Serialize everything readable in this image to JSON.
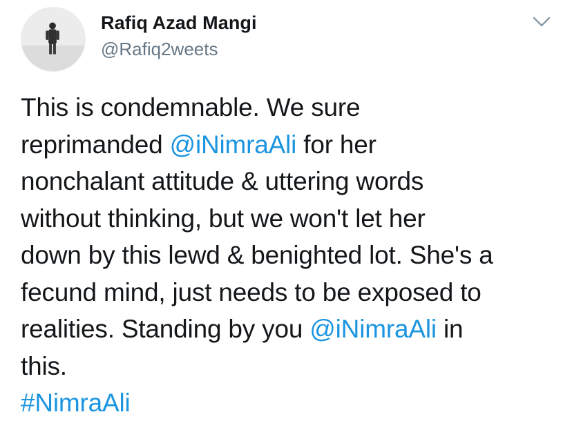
{
  "tweet": {
    "author": {
      "display_name": "Rafiq Azad Mangi",
      "handle": "@Rafiq2weets"
    },
    "body": {
      "line1": "This is condemnable. We sure",
      "line2_pre": "reprimanded ",
      "line2_mention": "@iNimraAli",
      "line2_post": " for her",
      "line3": "nonchalant attitude & uttering words",
      "line4": "without thinking, but we won't let her",
      "line5": "down by this lewd & benighted lot. She's a",
      "line6": "fecund mind, just needs to be exposed to",
      "line7_pre": "realities. Standing by you ",
      "line7_mention": "@iNimraAli",
      "line7_post": " in",
      "line8": "this.",
      "hashtag": "#NimraAli"
    }
  },
  "icons": {
    "menu": "chevron-down-icon",
    "avatar": "avatar"
  },
  "colors": {
    "text": "#14171a",
    "secondary": "#657786",
    "link": "#1b95e0",
    "chevron": "#8899a6"
  }
}
